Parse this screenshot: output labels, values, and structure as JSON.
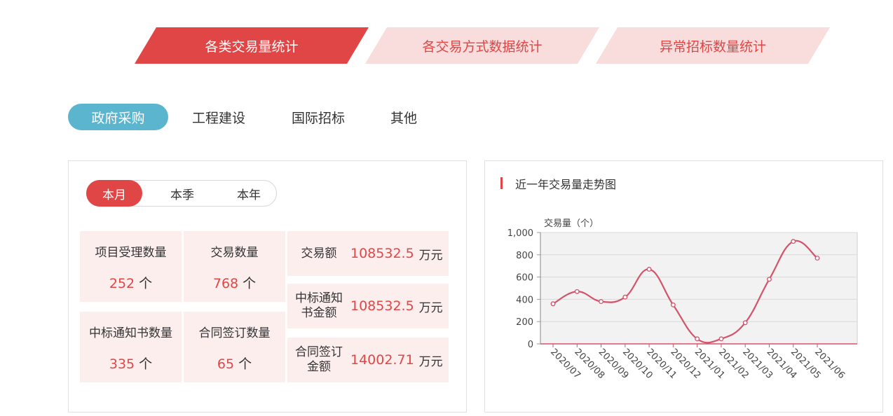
{
  "main_tabs": [
    "各类交易量统计",
    "各交易方式数据统计",
    "异常招标数量统计"
  ],
  "categories": [
    "政府采购",
    "工程建设",
    "国际招标",
    "其他"
  ],
  "periods": [
    "本月",
    "本季",
    "本年"
  ],
  "stats": [
    {
      "label": "项目受理数量",
      "value": "252",
      "unit": "个"
    },
    {
      "label": "交易数量",
      "value": "768",
      "unit": "个"
    },
    {
      "label": "中标通知书数量",
      "value": "335",
      "unit": "个"
    },
    {
      "label": "合同签订数量",
      "value": "65",
      "unit": "个"
    }
  ],
  "money": [
    {
      "label": "交易额",
      "value": "108532.5",
      "unit": "万元"
    },
    {
      "label": "中标通知书金额",
      "value": "108532.5",
      "unit": "万元"
    },
    {
      "label": "合同签订金额",
      "value": "14002.71",
      "unit": "万元"
    }
  ],
  "colors": {
    "accent": "#e04646",
    "accent_light": "#f9dcdc",
    "pill_active": "#5bb5cf",
    "line": "#d4526a",
    "plot_bg": "#f2f2f2"
  },
  "chart_data": {
    "type": "line",
    "title": "近一年交易量走势图",
    "ylabel": "交易量（个）",
    "ylim": [
      0,
      1000
    ],
    "yticks": [
      "0",
      "200",
      "400",
      "600",
      "800",
      "1,000"
    ],
    "categories": [
      "2020/07",
      "2020/08",
      "2020/09",
      "2020/10",
      "2020/11",
      "2020/12",
      "2021/01",
      "2021/02",
      "2021/03",
      "2021/04",
      "2021/05",
      "2021/06"
    ],
    "values": [
      360,
      470,
      380,
      420,
      670,
      350,
      45,
      45,
      190,
      580,
      920,
      770
    ],
    "grid": true
  }
}
